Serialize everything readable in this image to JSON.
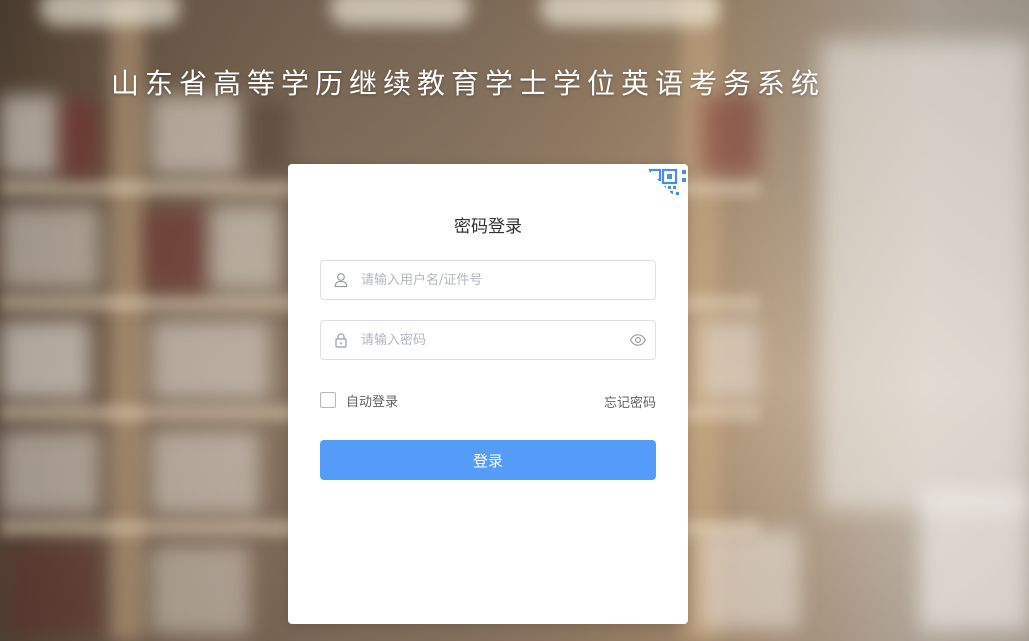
{
  "header": {
    "title": "山东省高等学历继续教育学士学位英语考务系统"
  },
  "login": {
    "title": "密码登录",
    "qr_toggle_icon": "qr-code-icon",
    "username": {
      "icon": "user-icon",
      "value": "",
      "placeholder": "请输入用户名/证件号"
    },
    "password": {
      "icon": "lock-icon",
      "suffix_icon": "eye-icon",
      "value": "",
      "placeholder": "请输入密码"
    },
    "remember_label": "自动登录",
    "remember_checked": false,
    "forgot_label": "忘记密码",
    "submit_label": "登录"
  },
  "colors": {
    "primary": "#539df9",
    "qr_accent": "#4a90e2",
    "card_background": "#ffffff"
  }
}
